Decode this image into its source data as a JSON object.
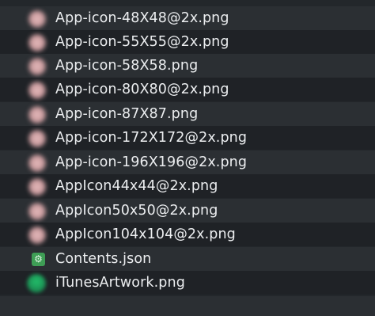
{
  "files": [
    {
      "name": "App-icon-48X48@2x.png",
      "icon": "image-thumbnail-icon"
    },
    {
      "name": "App-icon-55X55@2x.png",
      "icon": "image-thumbnail-icon"
    },
    {
      "name": "App-icon-58X58.png",
      "icon": "image-thumbnail-icon"
    },
    {
      "name": "App-icon-80X80@2x.png",
      "icon": "image-thumbnail-icon"
    },
    {
      "name": "App-icon-87X87.png",
      "icon": "image-thumbnail-icon"
    },
    {
      "name": "App-icon-172X172@2x.png",
      "icon": "image-thumbnail-icon"
    },
    {
      "name": "App-icon-196X196@2x.png",
      "icon": "image-thumbnail-icon"
    },
    {
      "name": "AppIcon44x44@2x.png",
      "icon": "image-thumbnail-icon"
    },
    {
      "name": "AppIcon50x50@2x.png",
      "icon": "image-thumbnail-icon"
    },
    {
      "name": "AppIcon104x104@2x.png",
      "icon": "image-thumbnail-icon"
    },
    {
      "name": "Contents.json",
      "icon": "json-file-icon"
    },
    {
      "name": "iTunesArtwork.png",
      "icon": "image-thumbnail-icon"
    }
  ],
  "colors": {
    "background": "#23272b",
    "row_even": "#2b2f33",
    "row_odd": "#1f2226",
    "text": "#eceef0",
    "json_icon": "#3e9d55"
  }
}
